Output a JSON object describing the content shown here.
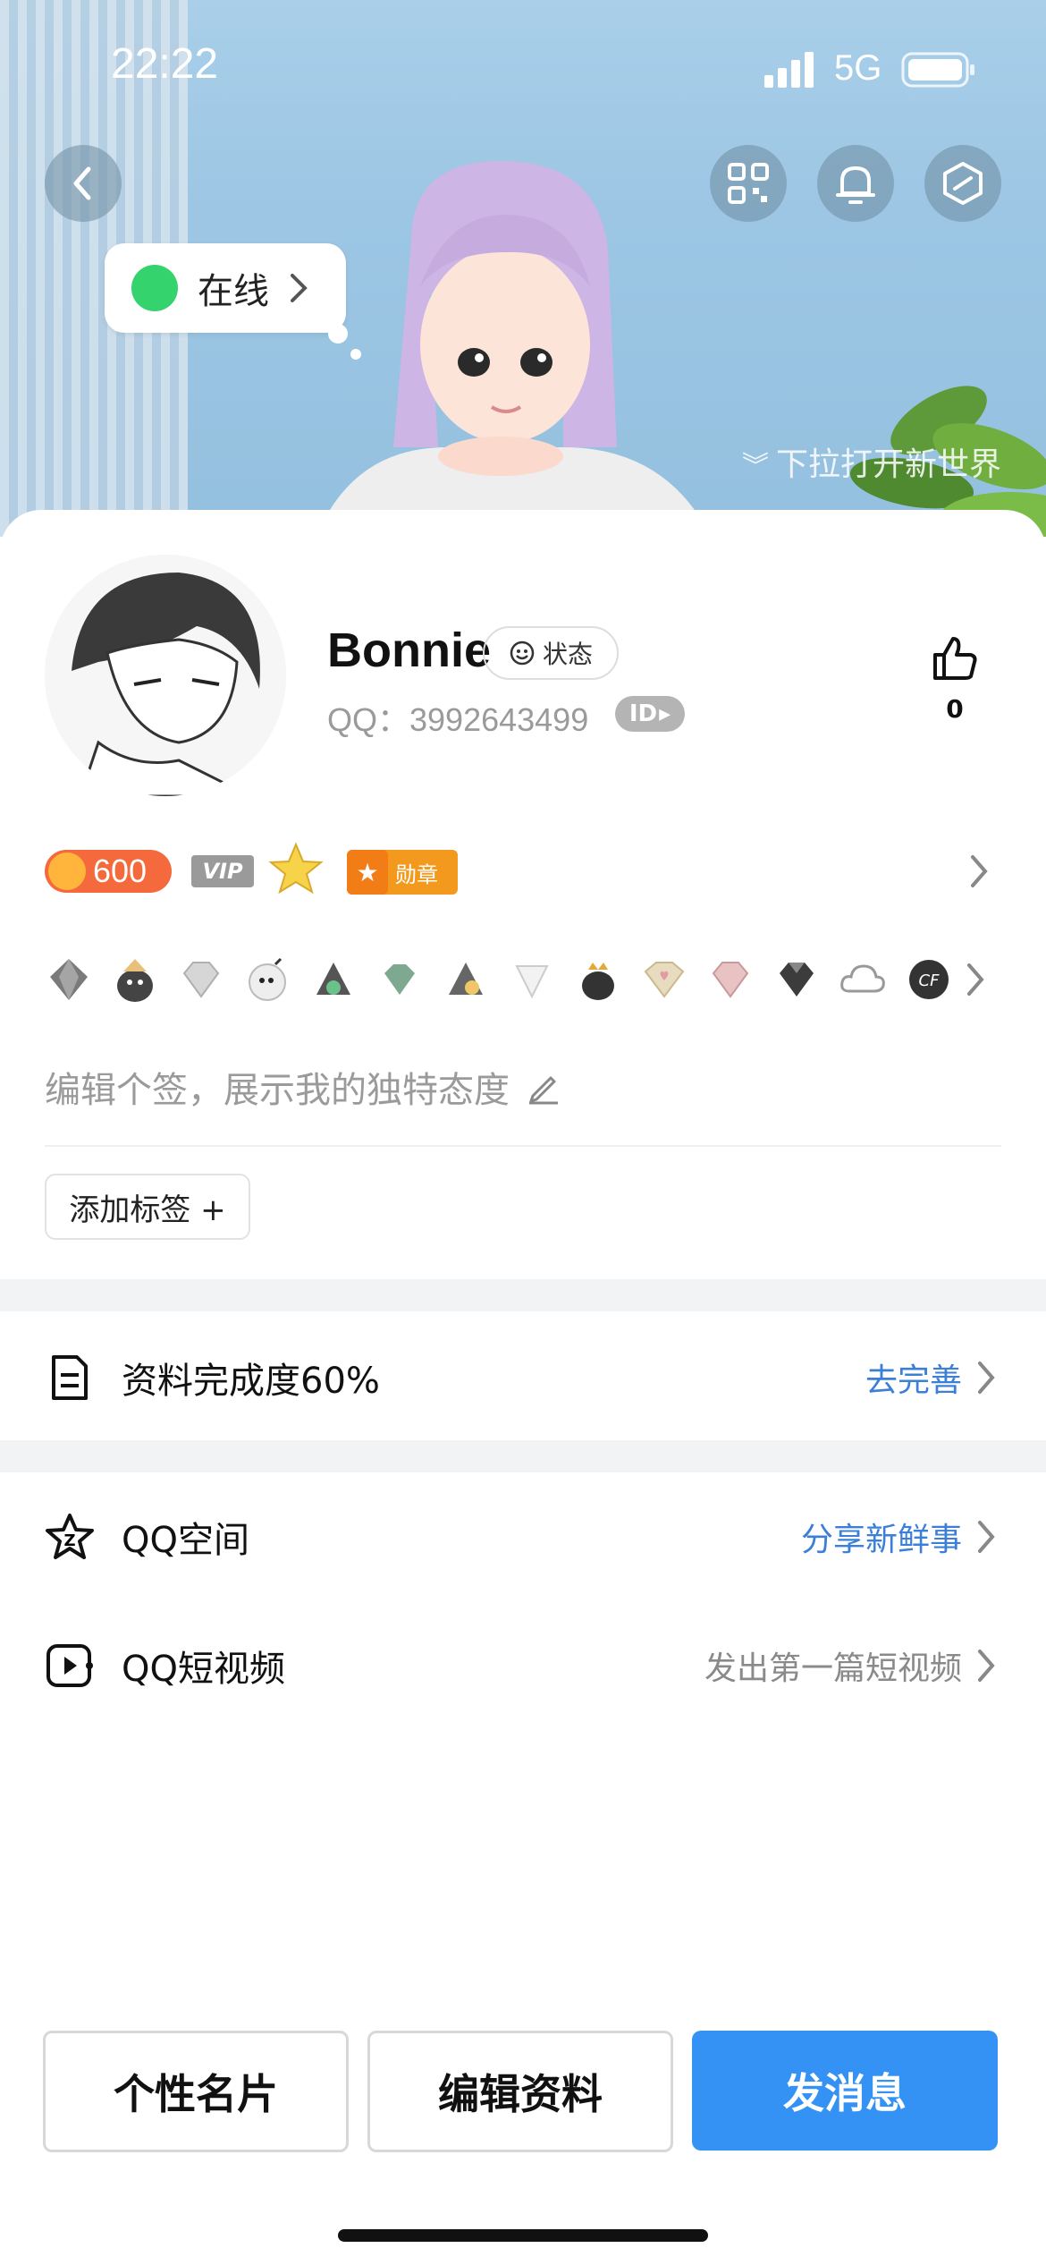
{
  "status_bar": {
    "time": "22:22",
    "network": "5G"
  },
  "header": {
    "online_status": "在线",
    "drag_hint": "下拉打开新世界",
    "icons": [
      "back-icon",
      "qrcode-icon",
      "bell-icon",
      "hexagon-settings-icon"
    ]
  },
  "profile": {
    "nickname": "Bonnie",
    "status_chip": "状态",
    "qq_label": "QQ：3992643499",
    "id_badge": "ID",
    "likes": "0"
  },
  "badges": {
    "coin_value": "600",
    "vip_label": "VIP",
    "medal_label": "勋章"
  },
  "bio_placeholder": "编辑个签，展示我的独特态度",
  "add_tag_label": "添加标签 +",
  "rows": [
    {
      "label": "资料完成度60%",
      "right": "去完善",
      "right_color": "#3b7fd9",
      "icon": "document-icon"
    },
    {
      "label": "QQ空间",
      "right": "分享新鲜事",
      "right_color": "#3b7fd9",
      "icon": "star-icon"
    },
    {
      "label": "QQ短视频",
      "right": "发出第一篇短视频",
      "right_color": "#8a8a8a",
      "icon": "video-icon"
    }
  ],
  "buttons": {
    "card": "个性名片",
    "edit": "编辑资料",
    "message": "发消息"
  },
  "colors": {
    "accent": "#3592f5",
    "online": "#34d36d"
  }
}
